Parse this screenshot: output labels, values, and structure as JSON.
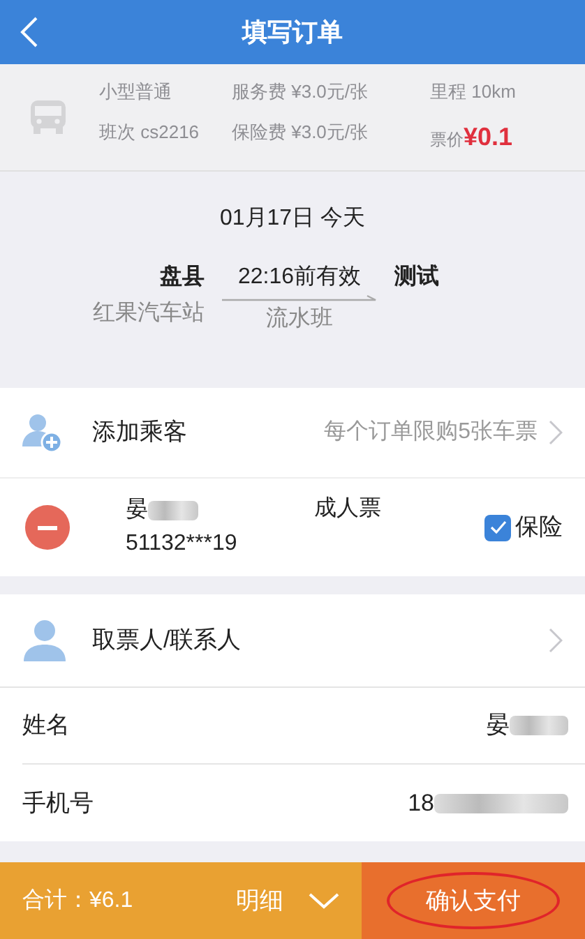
{
  "header": {
    "title": "填写订单"
  },
  "ticket_info": {
    "type": "小型普通",
    "service_fee": "服务费 ¥3.0元/张",
    "distance": "里程 10km",
    "trip": "班次 cs2216",
    "insurance_fee": "保险费 ¥3.0元/张",
    "price_label": "票价",
    "price": "¥0.1"
  },
  "route": {
    "date": "01月17日 今天",
    "from": "盘县",
    "from_station": "红果汽车站",
    "valid": "22:16前有效",
    "schedule": "流水班",
    "to": "测试"
  },
  "add_passenger": {
    "label": "添加乘客",
    "hint": "每个订单限购5张车票"
  },
  "passengers": [
    {
      "name": "晏",
      "id": "51132***19",
      "ticket_type": "成人票",
      "insurance_label": "保险",
      "insured": true
    }
  ],
  "contact": {
    "label": "取票人/联系人"
  },
  "fields": [
    {
      "label": "姓名",
      "value": "晏"
    },
    {
      "label": "手机号",
      "value": "18"
    }
  ],
  "footer": {
    "total": "合计：¥6.1",
    "detail": "明细",
    "pay": "确认支付"
  }
}
